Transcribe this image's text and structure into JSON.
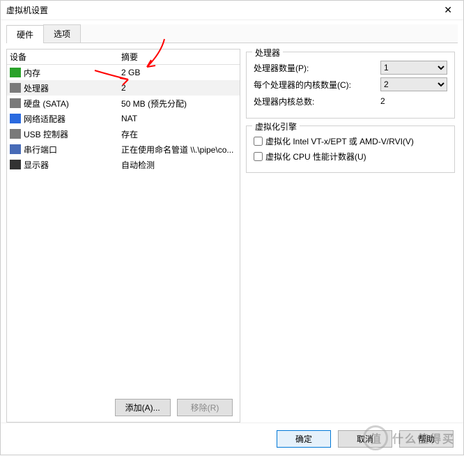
{
  "window": {
    "title": "虚拟机设置"
  },
  "tabs": {
    "hardware": "硬件",
    "options": "选项"
  },
  "listHeader": {
    "device": "设备",
    "summary": "摘要"
  },
  "devices": [
    {
      "name": "内存",
      "summary": "2 GB",
      "iconColor": "#2aa22a"
    },
    {
      "name": "处理器",
      "summary": "2",
      "iconColor": "#7a7a7a",
      "selected": true
    },
    {
      "name": "硬盘 (SATA)",
      "summary": "50 MB (预先分配)",
      "iconColor": "#7a7a7a"
    },
    {
      "name": "网络适配器",
      "summary": "NAT",
      "iconColor": "#2a6adf"
    },
    {
      "name": "USB 控制器",
      "summary": "存在",
      "iconColor": "#7a7a7a"
    },
    {
      "name": "串行端口",
      "summary": "正在使用命名管道 \\\\.\\pipe\\co...",
      "iconColor": "#476bb7"
    },
    {
      "name": "显示器",
      "summary": "自动检测",
      "iconColor": "#333333"
    }
  ],
  "leftButtons": {
    "add": "添加(A)...",
    "remove": "移除(R)"
  },
  "proc": {
    "group": "处理器",
    "countLabel": "处理器数量(P):",
    "countValue": "1",
    "coresLabel": "每个处理器的内核数量(C):",
    "coresValue": "2",
    "totalLabel": "处理器内核总数:",
    "totalValue": "2"
  },
  "virt": {
    "group": "虚拟化引擎",
    "vtx": "虚拟化 Intel VT-x/EPT 或 AMD-V/RVI(V)",
    "cpuCounter": "虚拟化 CPU 性能计数器(U)"
  },
  "footer": {
    "ok": "确定",
    "cancel": "取消",
    "help": "帮助"
  },
  "watermark": {
    "char": "值",
    "text": "什么值得买"
  }
}
